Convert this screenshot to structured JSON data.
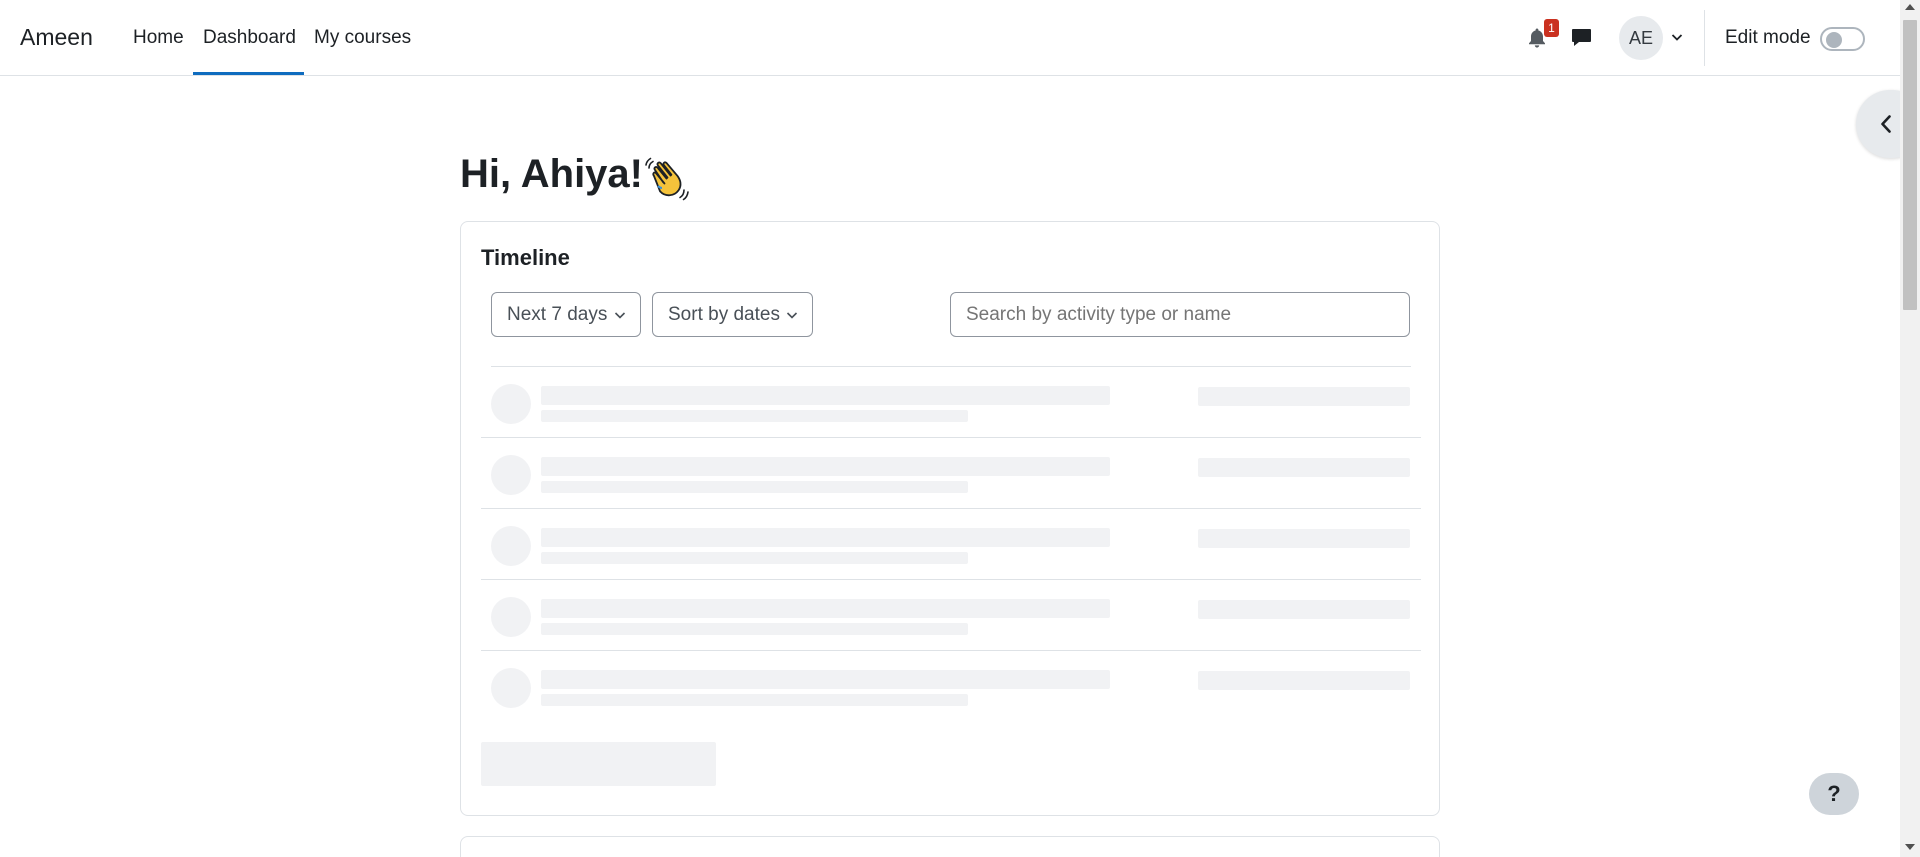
{
  "navbar": {
    "brand": "Ameen",
    "links": [
      {
        "label": "Home"
      },
      {
        "label": "Dashboard",
        "active": true
      },
      {
        "label": "My courses"
      }
    ],
    "notification_count": "1",
    "avatar_initials": "AE",
    "edit_mode_label": "Edit mode",
    "edit_mode_on": false
  },
  "main": {
    "greeting": "Hi, Ahiya!",
    "greeting_emoji": "waving-hand-icon"
  },
  "timeline": {
    "title": "Timeline",
    "filter_label": "Next 7 days",
    "sort_label": "Sort by dates",
    "search_placeholder": "Search by activity type or name",
    "loading_rows": 5
  },
  "help_label": "?",
  "colors": {
    "accent": "#0f6cbf",
    "badge": "#ca3120",
    "placeholder": "#f1f2f4",
    "border": "#dee2e6"
  },
  "icons": [
    "bell-icon",
    "chat-bubble-icon",
    "chevron-down-icon",
    "chevron-left-icon",
    "waving-hand-icon"
  ]
}
